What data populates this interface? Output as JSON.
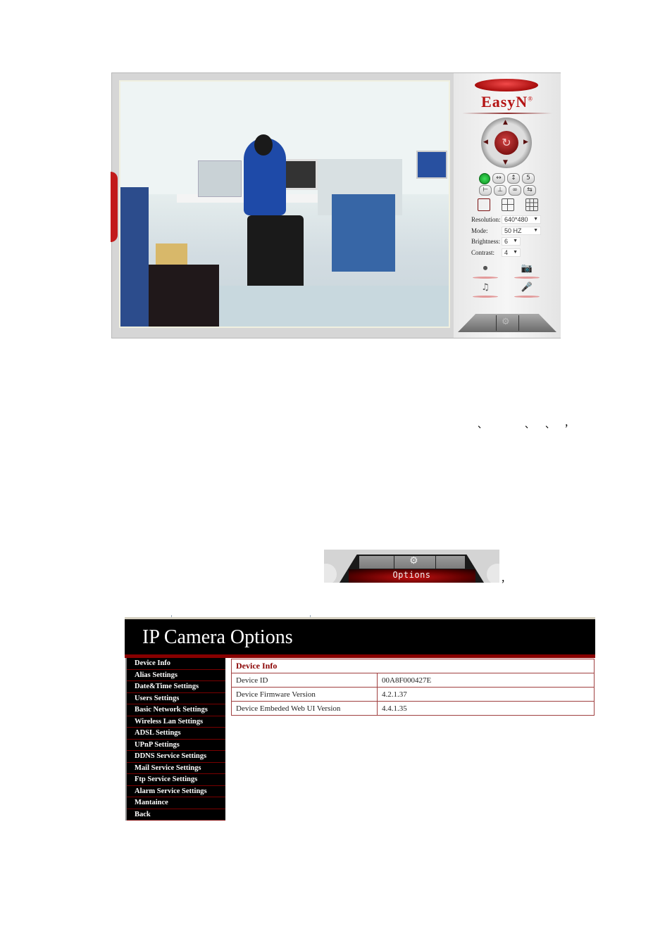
{
  "viewer": {
    "brand": "EasyN",
    "brand_mark": "®",
    "ptz": {
      "center_icon": "refresh-icon",
      "up": "▲",
      "down": "▼",
      "left": "◀",
      "right": "▶",
      "center": "↻"
    },
    "button_row_1": [
      {
        "icon": "status-led-icon",
        "glyph": ""
      },
      {
        "icon": "horizontal-flip-icon",
        "glyph": "↔"
      },
      {
        "icon": "vertical-flip-icon",
        "glyph": "↕"
      },
      {
        "icon": "preset-icon",
        "glyph": "5"
      }
    ],
    "button_row_2": [
      {
        "icon": "ir-icon",
        "glyph": "⊢"
      },
      {
        "icon": "patrol-icon",
        "glyph": "⊥"
      },
      {
        "icon": "link-icon",
        "glyph": "∞"
      },
      {
        "icon": "swap-icon",
        "glyph": "⇆"
      }
    ],
    "layouts": [
      "single-view",
      "quad-view",
      "nine-view"
    ],
    "settings": [
      {
        "label": "Resolution:",
        "value": "640*480"
      },
      {
        "label": "Mode:",
        "value": "50 HZ"
      },
      {
        "label": "Brightness:",
        "value": "6"
      },
      {
        "label": "Contrast:",
        "value": "4"
      }
    ],
    "actions": [
      {
        "name": "record-button",
        "glyph": "⏺"
      },
      {
        "name": "snapshot-button",
        "glyph": "📷"
      },
      {
        "name": "audio-button",
        "glyph": "♫"
      },
      {
        "name": "talk-button",
        "glyph": "🎤"
      }
    ],
    "bottom_gear": "⚙"
  },
  "punctuation": [
    "、",
    "、",
    "、",
    "，"
  ],
  "options_bar": {
    "gear": "⚙",
    "label": "Options",
    "trailing": "，"
  },
  "ip_options": {
    "title": "IP Camera Options",
    "menu": [
      "Device Info",
      "Alias Settings",
      "Date&Time Settings",
      "Users Settings",
      "Basic Network Settings",
      "Wireless Lan Settings",
      "ADSL Settings",
      "UPnP Settings",
      "DDNS Service Settings",
      "Mail Service Settings",
      "Ftp Service Settings",
      "Alarm Service Settings",
      "Mantaince",
      "Back"
    ],
    "device_info": {
      "heading": "Device Info",
      "rows": [
        {
          "key": "Device ID",
          "value": "00A8F000427E"
        },
        {
          "key": "Device Firmware Version",
          "value": "4.2.1.37"
        },
        {
          "key": "Device Embeded Web UI Version",
          "value": "4.4.1.35"
        }
      ]
    }
  },
  "colors": {
    "brand_red": "#b41414",
    "menu_bg": "#000000",
    "accent_dark_red": "#880000"
  }
}
